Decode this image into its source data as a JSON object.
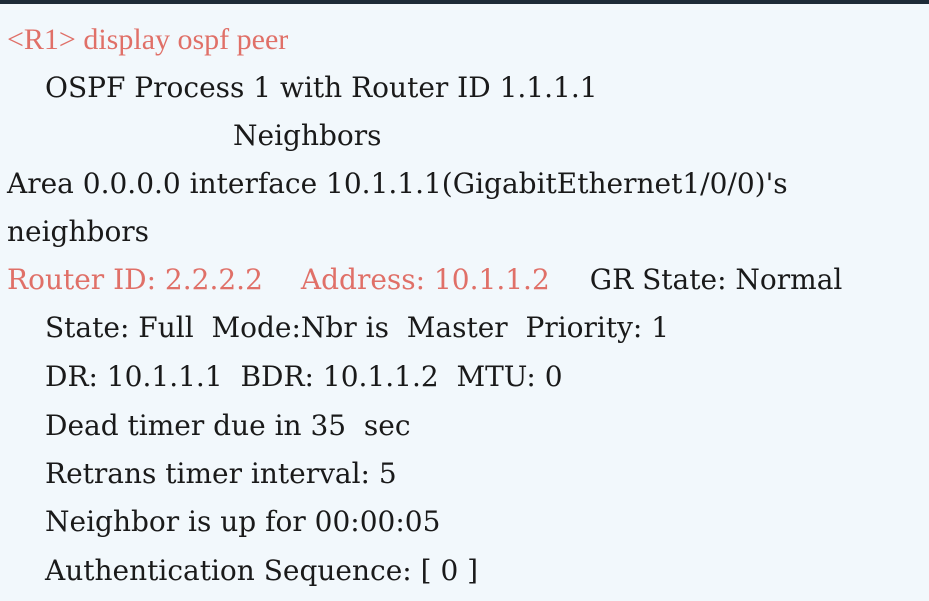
{
  "terminal": {
    "prompt": "<R1> display ospf peer",
    "process_line": "OSPF Process 1 with Router ID 1.1.1.1",
    "neighbors_heading": "Neighbors",
    "area_line_1": "Area 0.0.0.0 interface 10.1.1.1(GigabitEthernet1/0/0)'s",
    "area_line_2": "neighbors",
    "router_id": "Router ID: 2.2.2.2",
    "address": "Address: 10.1.1.2",
    "gr_state": "GR State: Normal",
    "state_line": "State: Full  Mode:Nbr is  Master  Priority: 1",
    "dr_line": "DR: 10.1.1.1  BDR: 10.1.1.2  MTU: 0",
    "dead_timer": "Dead timer due in 35  sec",
    "retrans": "Retrans timer interval: 5",
    "neighbor_up": "Neighbor is up for 00:00:05",
    "auth_seq": "Authentication Sequence: [ 0 ]"
  },
  "colors": {
    "background": "#f2f8fc",
    "text": "#1a1a1a",
    "highlight": "#e07068",
    "border": "#1e2b38"
  }
}
